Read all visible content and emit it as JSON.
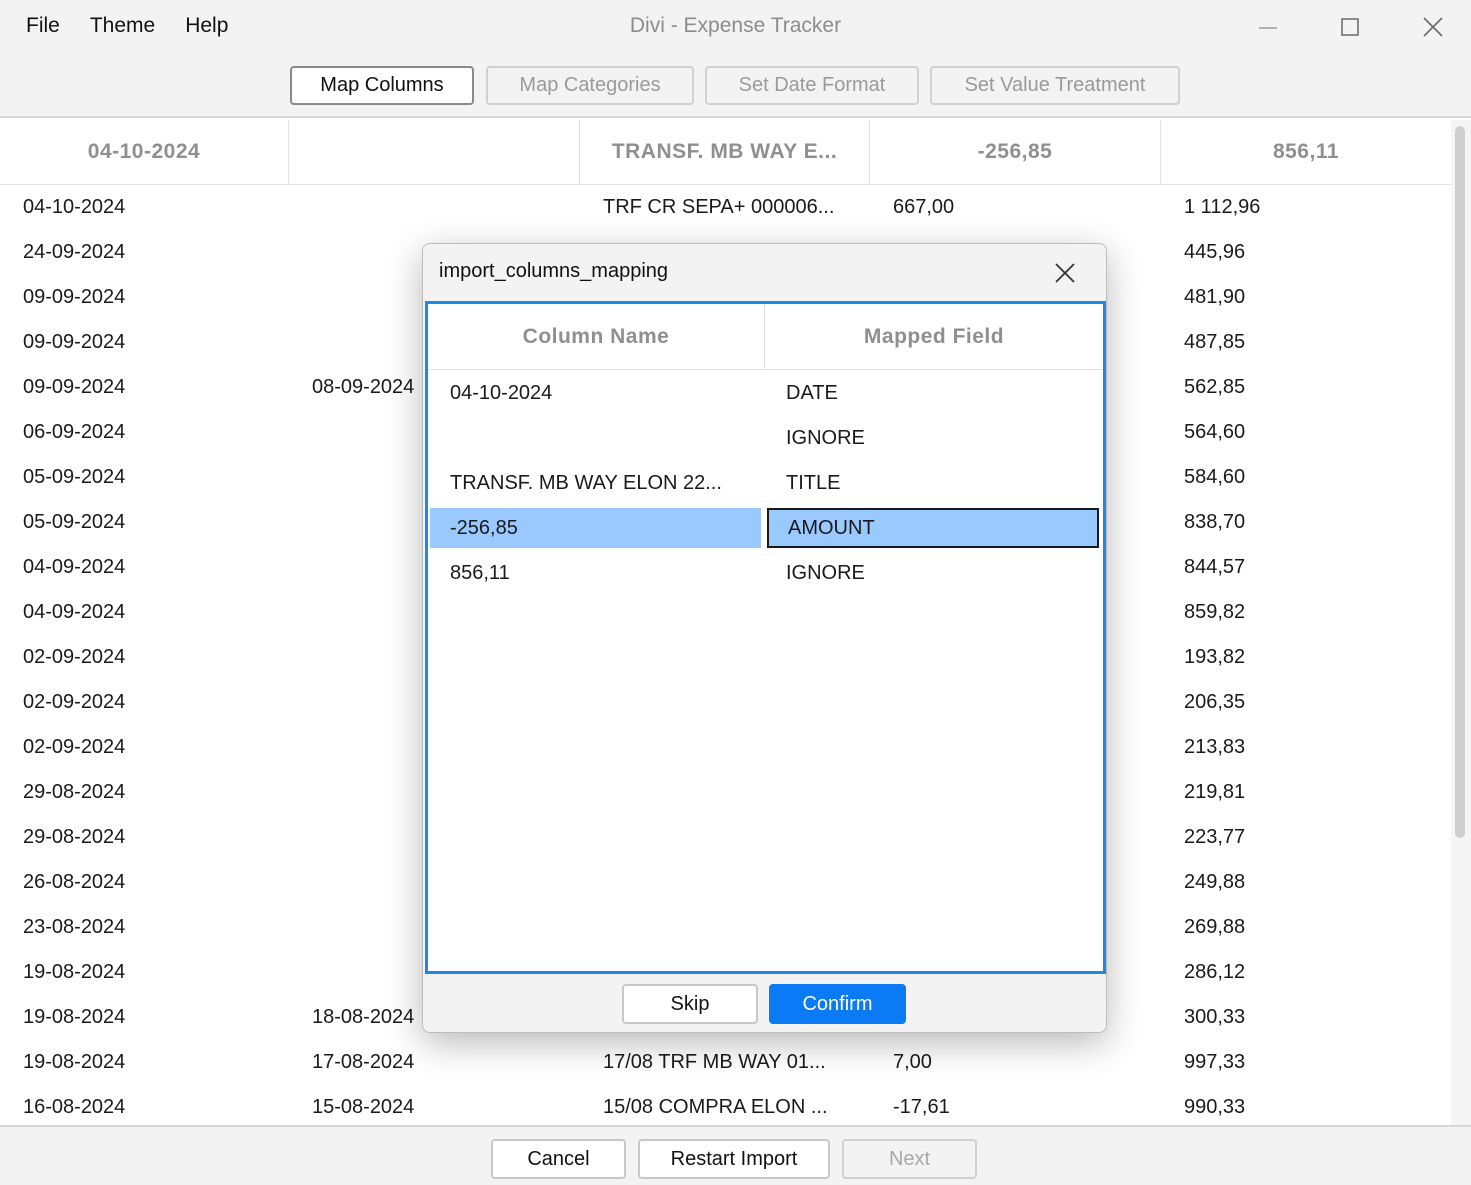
{
  "window": {
    "title": "Divi - Expense Tracker"
  },
  "menu": {
    "file": "File",
    "theme": "Theme",
    "help": "Help"
  },
  "steps": {
    "map_columns": "Map Columns",
    "map_categories": "Map Categories",
    "set_date_format": "Set Date Format",
    "set_value_treatment": "Set Value Treatment"
  },
  "table": {
    "headers": [
      "04-10-2024",
      "",
      "TRANSF. MB WAY E...",
      "-256,85",
      "856,11"
    ],
    "rows": [
      [
        "04-10-2024",
        "",
        "TRF CR SEPA+ 000006...",
        "667,00",
        "1 112,96"
      ],
      [
        "24-09-2024",
        "",
        "",
        "",
        "445,96"
      ],
      [
        "09-09-2024",
        "",
        "",
        "",
        "481,90"
      ],
      [
        "09-09-2024",
        "",
        "",
        "",
        "487,85"
      ],
      [
        "09-09-2024",
        "08-09-2024",
        "",
        "",
        "562,85"
      ],
      [
        "06-09-2024",
        "",
        "",
        "",
        "564,60"
      ],
      [
        "05-09-2024",
        "",
        "",
        "",
        "584,60"
      ],
      [
        "05-09-2024",
        "",
        "",
        "",
        "838,70"
      ],
      [
        "04-09-2024",
        "",
        "",
        "",
        "844,57"
      ],
      [
        "04-09-2024",
        "",
        "",
        "",
        "859,82"
      ],
      [
        "02-09-2024",
        "",
        "",
        "",
        "193,82"
      ],
      [
        "02-09-2024",
        "",
        "",
        "",
        "206,35"
      ],
      [
        "02-09-2024",
        "",
        "",
        "",
        "213,83"
      ],
      [
        "29-08-2024",
        "",
        "",
        "",
        "219,81"
      ],
      [
        "29-08-2024",
        "",
        "",
        "",
        "223,77"
      ],
      [
        "26-08-2024",
        "",
        "",
        "",
        "249,88"
      ],
      [
        "23-08-2024",
        "",
        "",
        "",
        "269,88"
      ],
      [
        "19-08-2024",
        "",
        "",
        "",
        "286,12"
      ],
      [
        "19-08-2024",
        "18-08-2024",
        "",
        "",
        "300,33"
      ],
      [
        "19-08-2024",
        "17-08-2024",
        "17/08 TRF MB WAY 01...",
        "7,00",
        "997,33"
      ],
      [
        "16-08-2024",
        "15-08-2024",
        "15/08 COMPRA ELON ...",
        "-17,61",
        "990,33"
      ]
    ]
  },
  "dialog": {
    "title": "import_columns_mapping",
    "headers": {
      "column_name": "Column Name",
      "mapped_field": "Mapped Field"
    },
    "rows": [
      {
        "column": "04-10-2024",
        "field": "DATE"
      },
      {
        "column": "",
        "field": "IGNORE"
      },
      {
        "column": "TRANSF. MB WAY ELON 22...",
        "field": "TITLE"
      },
      {
        "column": "-256,85",
        "field": "AMOUNT"
      },
      {
        "column": "856,11",
        "field": "IGNORE"
      }
    ],
    "selected_row": 3,
    "skip": "Skip",
    "confirm": "Confirm"
  },
  "footer": {
    "cancel": "Cancel",
    "restart": "Restart Import",
    "next": "Next"
  },
  "colors": {
    "accent": "#0a7bf5",
    "selection": "#99c9ff",
    "focus_border": "#1e88e5"
  },
  "icons": {
    "minimize": "minimize-icon",
    "maximize": "maximize-icon",
    "close": "close-icon"
  }
}
